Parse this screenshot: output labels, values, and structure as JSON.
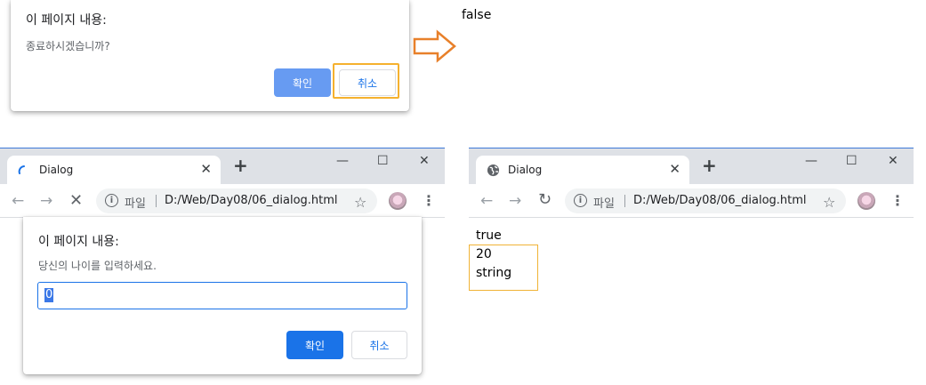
{
  "dialog_exit": {
    "title": "이 페이지 내용:",
    "message": "종료하시겠습니까?",
    "ok_label": "확인",
    "cancel_label": "취소"
  },
  "result_top": {
    "text": "false"
  },
  "left_browser": {
    "tab_title": "Dialog",
    "tab_close": "✕",
    "new_tab": "+",
    "win_minimize": "—",
    "win_maximize": "☐",
    "win_close": "✕",
    "omnibox_label": "파일",
    "url": "D:/Web/Day08/06_dialog.html",
    "icons": [
      "loading-spinner-icon",
      "back-icon",
      "forward-icon",
      "stop-icon",
      "info-icon",
      "star-icon",
      "avatar",
      "kebab-menu-icon"
    ]
  },
  "prompt_dialog": {
    "title": "이 페이지 내용:",
    "message": "당신의 나이를 입력하세요.",
    "input_value": "0",
    "ok_label": "확인",
    "cancel_label": "취소"
  },
  "right_browser": {
    "tab_title": "Dialog",
    "tab_close": "✕",
    "new_tab": "+",
    "win_minimize": "—",
    "win_maximize": "☐",
    "win_close": "✕",
    "omnibox_label": "파일",
    "url": "D:/Web/Day08/06_dialog.html",
    "output_lines": [
      "true",
      "20",
      "string"
    ],
    "icons": [
      "globe-icon",
      "back-icon",
      "forward-icon",
      "reload-icon",
      "info-icon",
      "star-icon",
      "avatar",
      "kebab-menu-icon"
    ]
  },
  "colors": {
    "accent_blue": "#1a73e8",
    "highlight_orange": "#f5b12e",
    "arrow_orange": "#e8802a",
    "tabstrip_gray": "#dee1e6"
  }
}
